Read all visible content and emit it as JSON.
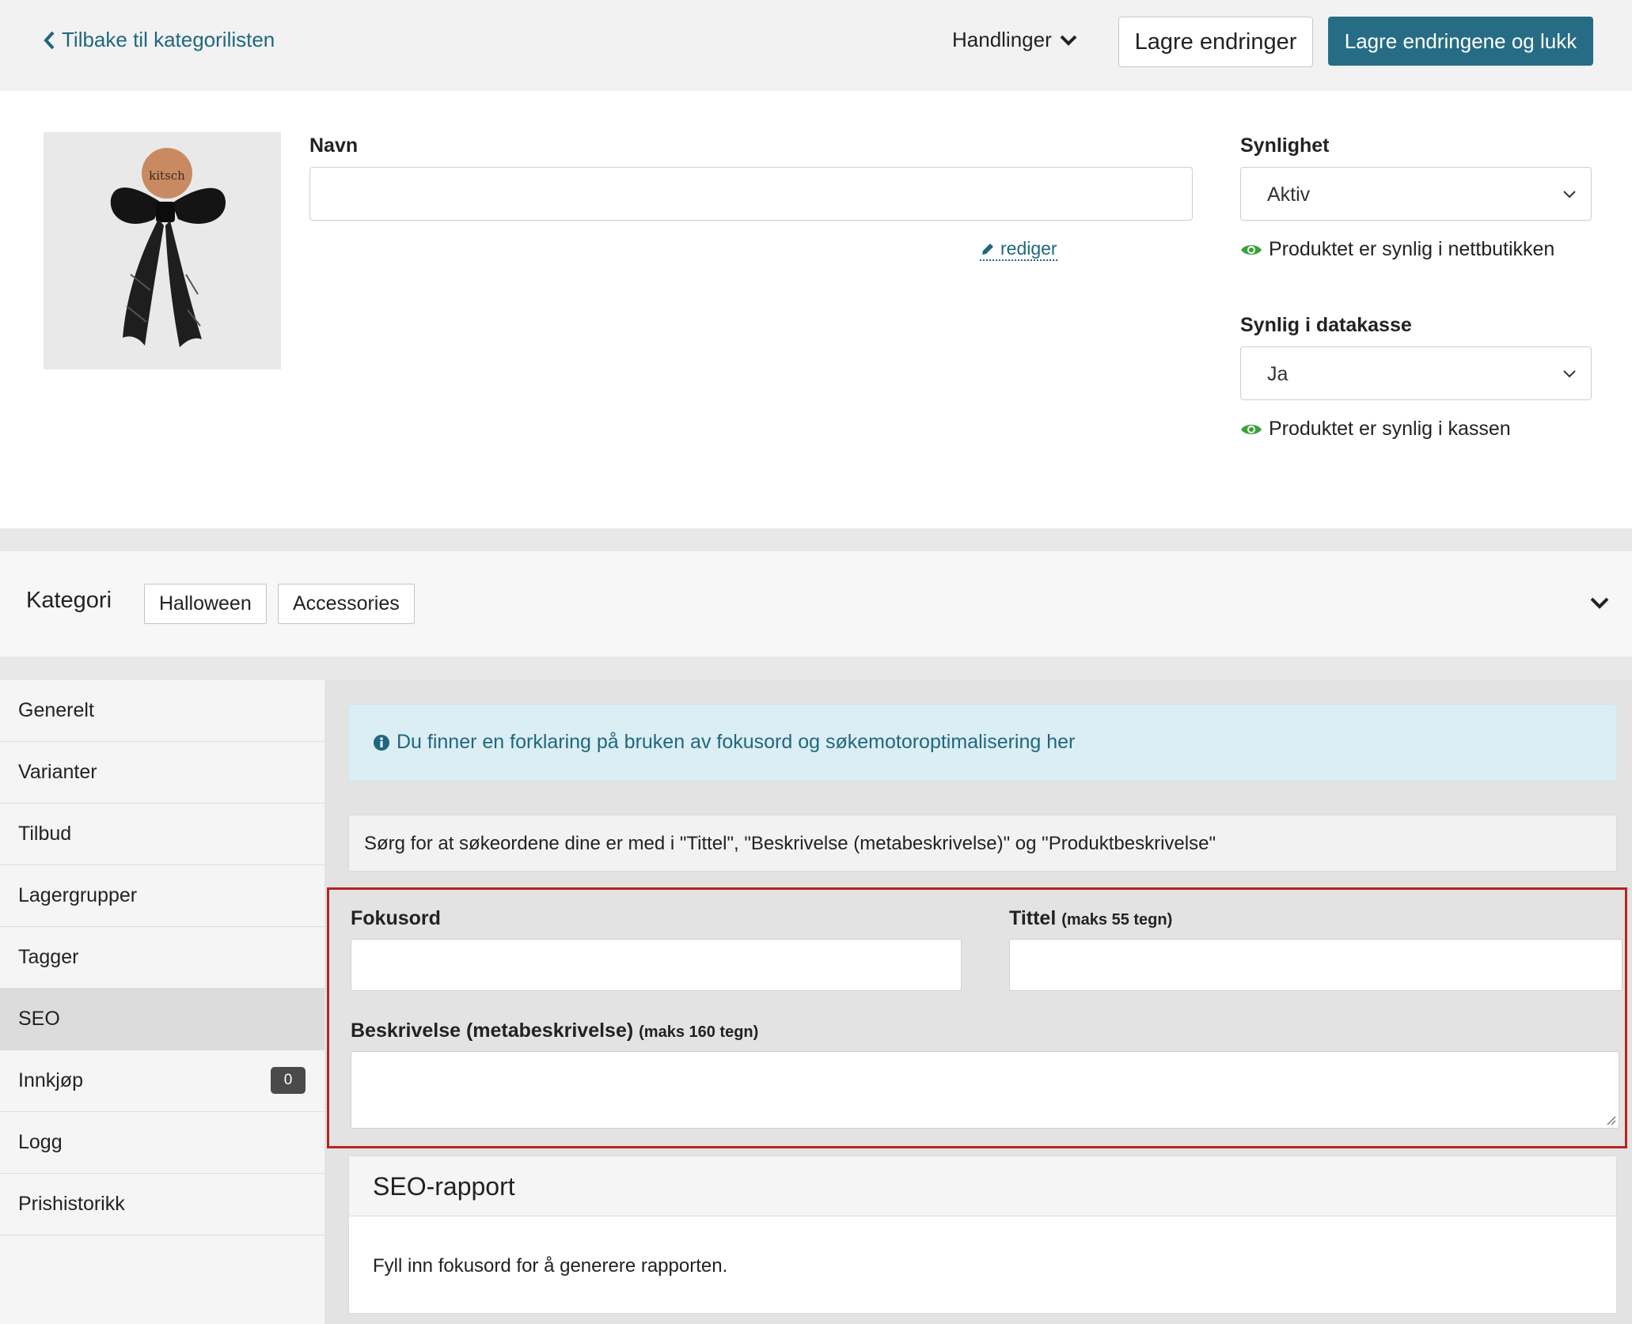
{
  "topbar": {
    "back_label": "Tilbake til kategorilisten",
    "actions_label": "Handlinger",
    "save_label": "Lagre endringer",
    "save_close_label": "Lagre endringene og lukk"
  },
  "product": {
    "image_brand": "kitsch",
    "name_label": "Navn",
    "name_value": "",
    "edit_label": "rediger",
    "visibility_label": "Synlighet",
    "visibility_value": "Aktiv",
    "visibility_status": "Produktet er synlig i nettbutikken",
    "pos_label": "Synlig i datakasse",
    "pos_value": "Ja",
    "pos_status": "Produktet er synlig i kassen"
  },
  "category": {
    "label": "Kategori",
    "chips": [
      "Halloween",
      "Accessories"
    ]
  },
  "sidenav": {
    "items": [
      {
        "label": "Generelt"
      },
      {
        "label": "Varianter"
      },
      {
        "label": "Tilbud"
      },
      {
        "label": "Lagergrupper"
      },
      {
        "label": "Tagger"
      },
      {
        "label": "SEO"
      },
      {
        "label": "Innkjøp",
        "badge": "0"
      },
      {
        "label": "Logg"
      },
      {
        "label": "Prishistorikk"
      }
    ],
    "active": "SEO"
  },
  "seo": {
    "info_text": "Du finner en forklaring på bruken av fokusord og søkemotoroptimalisering her",
    "hint_text": "Sørg for at søkeordene dine er med i \"Tittel\", \"Beskrivelse (metabeskrivelse)\" og \"Produktbeskrivelse\"",
    "focus_label": "Fokusord",
    "focus_value": "",
    "title_label": "Tittel",
    "title_hint": "(maks 55 tegn)",
    "title_value": "",
    "desc_label": "Beskrivelse (metabeskrivelse)",
    "desc_hint": "(maks 160 tegn)",
    "desc_value": ""
  },
  "report": {
    "title": "SEO-rapport",
    "body": "Fyll inn fokusord for å generere rapporten."
  },
  "colors": {
    "primary": "#266c85",
    "link": "#1f6781",
    "status_eye": "#3aa23a",
    "highlight_border": "#b3261e",
    "info_bg": "#dbeef3"
  }
}
